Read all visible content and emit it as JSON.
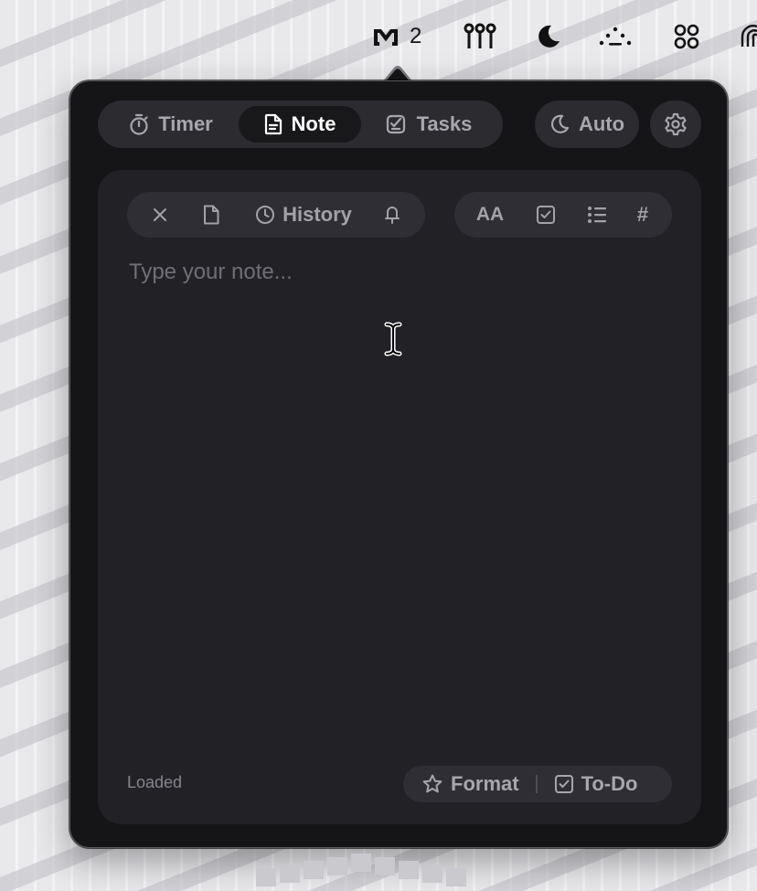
{
  "menubar": {
    "space_count": "2"
  },
  "nav": {
    "tabs": [
      {
        "label": "Timer",
        "icon": "stopwatch-icon",
        "active": false
      },
      {
        "label": "Note",
        "icon": "document-icon",
        "active": true
      },
      {
        "label": "Tasks",
        "icon": "checklist-icon",
        "active": false
      }
    ],
    "theme_label": "Auto",
    "theme_icon": "moon-icon",
    "settings_icon": "gear-icon"
  },
  "toolbar": {
    "history_label": "History",
    "text_size_label": "AA",
    "heading_label": "#"
  },
  "editor": {
    "placeholder": "Type your note...",
    "value": ""
  },
  "footer": {
    "status": "Loaded",
    "format_label": "Format",
    "todo_label": "To-Do"
  },
  "colors": {
    "popover_bg": "#151518",
    "card_bg": "#212126",
    "pill_bg": "#2b2b30",
    "active_tab_bg": "#18181b",
    "text_muted": "#a7a7ad",
    "text_active": "#ffffff"
  }
}
